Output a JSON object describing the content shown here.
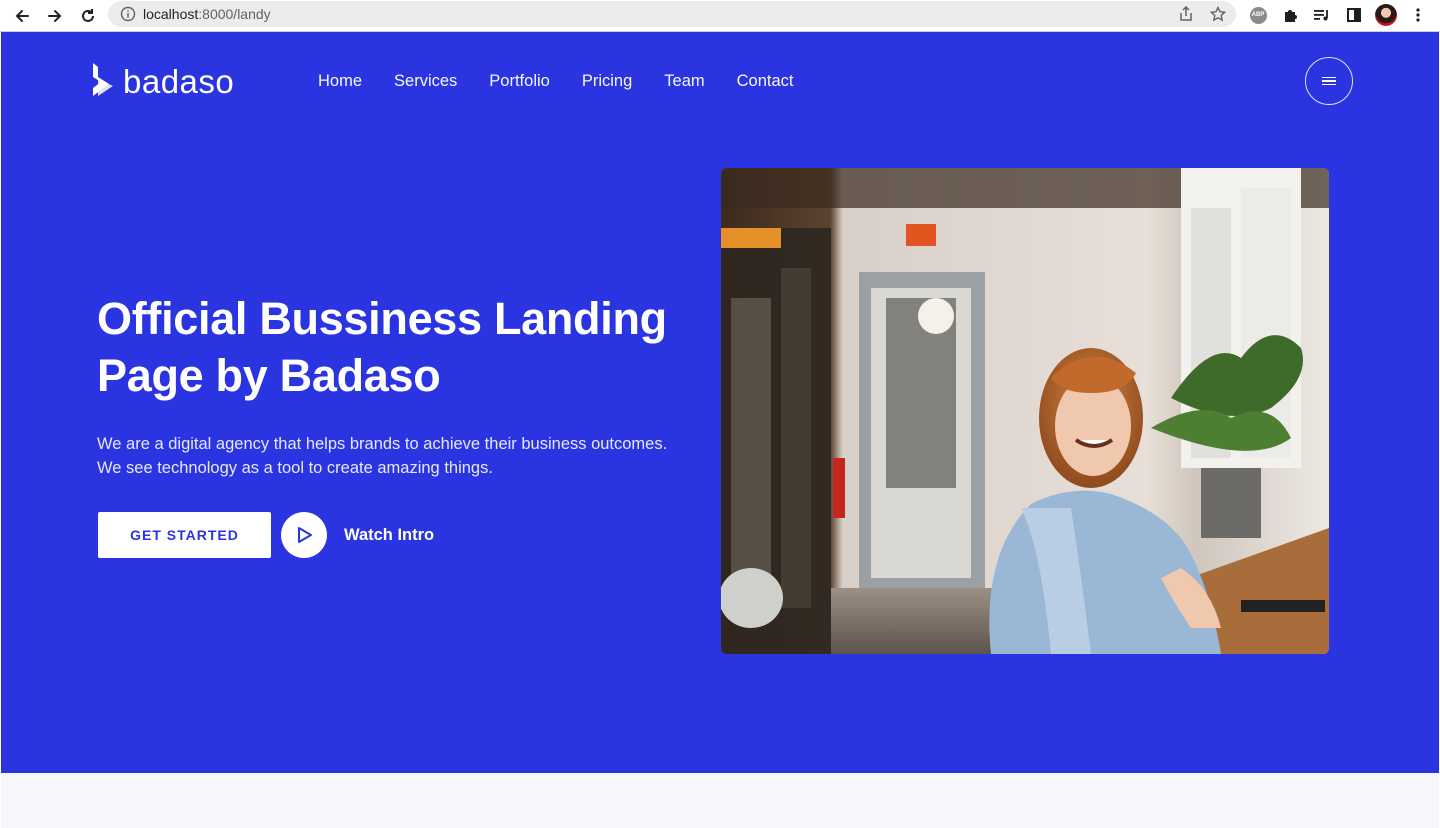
{
  "browser": {
    "url_host": "localhost",
    "url_path": ":8000/landy"
  },
  "site": {
    "logo_text": "badaso",
    "nav": [
      {
        "label": "Home"
      },
      {
        "label": "Services"
      },
      {
        "label": "Portfolio"
      },
      {
        "label": "Pricing"
      },
      {
        "label": "Team"
      },
      {
        "label": "Contact"
      }
    ]
  },
  "hero": {
    "title": "Official Bussiness Landing Page by Badaso",
    "description_line1": "We are a digital agency that helps brands to achieve their business outcomes.",
    "description_line2": "We see technology as a tool to create amazing things.",
    "cta_label": "GET STARTED",
    "watch_label": "Watch Intro",
    "image_alt": "hero-photo"
  },
  "colors": {
    "primary": "#2b34e1",
    "below_bg": "#f7f8fd"
  },
  "icons": [
    "back-arrow-icon",
    "forward-arrow-icon",
    "reload-icon",
    "info-icon",
    "share-icon",
    "star-icon",
    "adblock-icon",
    "puzzle-icon",
    "media-list-icon",
    "sidepanel-icon",
    "profile-avatar",
    "more-vert-icon",
    "hamburger-icon",
    "play-icon"
  ]
}
